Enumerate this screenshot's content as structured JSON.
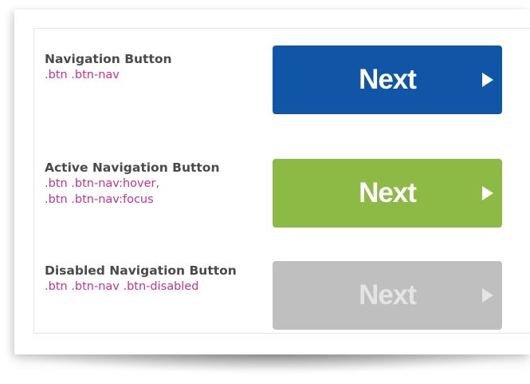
{
  "items": [
    {
      "title": "Navigation Button",
      "classes": [
        ".btn .btn-nav"
      ],
      "button": {
        "label": "Next",
        "color": "#1155a6",
        "state": "normal"
      }
    },
    {
      "title": "Active Navigation Button",
      "classes": [
        ".btn .btn-nav:hover,",
        ".btn .btn-nav:focus"
      ],
      "button": {
        "label": "Next",
        "color": "#8db945",
        "state": "hover/focus"
      }
    },
    {
      "title": "Disabled Navigation Button",
      "classes": [
        ".btn .btn-nav .btn-disabled"
      ],
      "button": {
        "label": "Next",
        "color": "#bfbfbf",
        "state": "disabled"
      }
    }
  ],
  "arrow_icon": "play-triangle-right-icon",
  "colors": {
    "title_text": "#4a4a4a",
    "class_text": "#c4338c",
    "button_text": "#ffffff",
    "disabled_text": "#e4e4e4"
  }
}
